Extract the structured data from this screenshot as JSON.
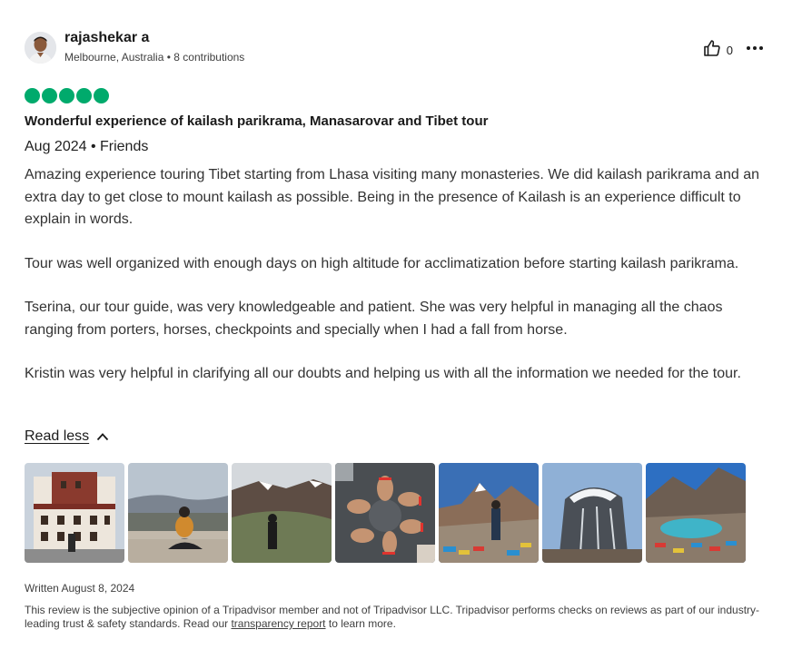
{
  "review": {
    "user": {
      "name": "rajashekar a",
      "meta": "Melbourne, Australia • 8 contributions"
    },
    "helpful_count": "0",
    "rating": 5,
    "rating_color": "#00aa6c",
    "title": "Wonderful experience of kailash parikrama, Manasarovar and Tibet tour",
    "trip": "Aug 2024 • Friends",
    "paragraphs": [
      "Amazing experience touring Tibet starting from Lhasa visiting many monasteries. We did kailash parikrama and an extra day to get close to mount kailash as possible. Being in the presence of Kailash is an experience difficult to explain in words.",
      "Tour was well organized with enough days on high altitude for acclimatization before starting kailash parikrama.",
      "Tserina, our tour guide, was very knowledgeable and patient. She was very helpful in managing all the chaos ranging from porters, horses, checkpoints and specially when I had a fall from horse.",
      "Kristin was very helpful in clarifying all our doubts and helping us with all the information we needed for the tour."
    ],
    "read_less": "Read less",
    "written": "Written August 8, 2024",
    "disclaimer_before": "This review is the subjective opinion of a Tripadvisor member and not of Tripadvisor LLC. Tripadvisor performs checks on reviews as part of our industry-leading trust & safety standards. Read our ",
    "disclaimer_link": "transparency report",
    "disclaimer_after": " to learn more."
  },
  "icons": {
    "helpful": "thumbs-up-icon",
    "more": "more-options-icon",
    "read_less": "chevron-up-icon"
  }
}
